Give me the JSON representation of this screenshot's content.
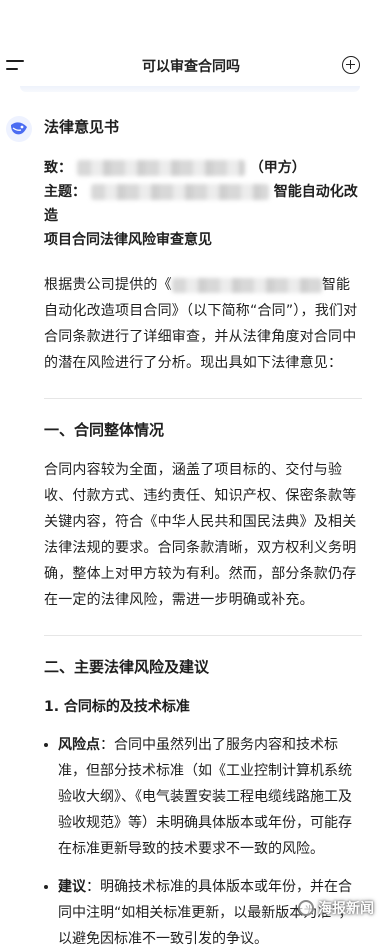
{
  "header": {
    "title": "可以审查合同吗",
    "menu_icon": "menu-icon",
    "new_chat_icon": "plus-circle-icon"
  },
  "message": {
    "avatar_icon": "assistant-logo-icon",
    "doc_title": "法律意见书",
    "to_label": "致：",
    "to_suffix": "（甲方）",
    "subject_label": "主题：",
    "subject_visible_tail": "智能自动化改造",
    "subject_line2": "项目合同法律风险审查意见",
    "intro_start": "根据贵公司提供的《",
    "intro_rest": "智能自动化改造项目合同》（以下简称“合同”），我们对合同条款进行了详细审查，并从法律角度对合同中的潜在风险进行了分析。现出具如下法律意见：",
    "section1_title": "一、合同整体情况",
    "section1_body": "合同内容较为全面，涵盖了项目标的、交付与验收、付款方式、违约责任、知识产权、保密条款等关键内容，符合《中华人民共和国民法典》及相关法律法规的要求。合同条款清晰，双方权利义务明确，整体上对甲方较为有利。然而，部分条款仍存在一定的法律风险，需进一步明确或补充。",
    "section2_title": "二、主要法律风险及建议",
    "subsection1_title": "1. 合同标的及技术标准",
    "bullet1_label": "风险点",
    "bullet1_text": "：合同中虽然列出了服务内容和技术标准，但部分技术标准（如《工业控制计算机系统验收大纲》、《电气装置安装工程电缆线路施工及验收规范》等）未明确具体版本或年份，可能存在标准更新导致的技术要求不一致的风险。",
    "bullet2_label": "建议",
    "bullet2_text": "：明确技术标准的具体版本或年份，并在合同中注明“如相关标准更新，以最新版本为准”，以避免因标准不一致引发的争议。"
  },
  "watermark": {
    "text": "海报新闻"
  }
}
